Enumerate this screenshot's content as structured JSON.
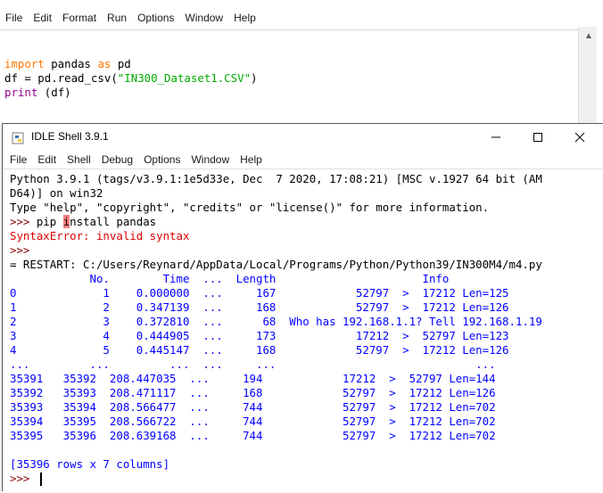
{
  "editor": {
    "menu": [
      "File",
      "Edit",
      "Format",
      "Run",
      "Options",
      "Window",
      "Help"
    ],
    "code": {
      "line1": {
        "kw1": "import",
        "mid": " pandas ",
        "kw2": "as",
        "end": " pd"
      },
      "line2": {
        "pre": "df = pd.read_csv(",
        "str": "\"IN300_Dataset1.CSV\"",
        "post": ")"
      },
      "line3": {
        "bi": "print",
        "post": " (df)"
      }
    }
  },
  "shell": {
    "title": "IDLE Shell 3.9.1",
    "menu": [
      "File",
      "Edit",
      "Shell",
      "Debug",
      "Options",
      "Window",
      "Help"
    ],
    "banner1": "Python 3.9.1 (tags/v3.9.1:1e5d33e, Dec  7 2020, 17:08:21) [MSC v.1927 64 bit (AM",
    "banner2": "D64)] on win32",
    "banner3": "Type \"help\", \"copyright\", \"credits\" or \"license()\" for more information.",
    "cmd": {
      "prompt": ">>> ",
      "pre": "pip ",
      "hl": "i",
      "post": "nstall pandas"
    },
    "error": "SyntaxError: invalid syntax",
    "prompt2": ">>>",
    "restart": "= RESTART: C:/Users/Reynard/AppData/Local/Programs/Python/Python39/IN300M4/m4.py",
    "table_lines": [
      "            No.        Time  ...  Length                      Info",
      "0             1    0.000000  ...     167            52797  >  17212 Len=125",
      "1             2    0.347139  ...     168            52797  >  17212 Len=126",
      "2             3    0.372810  ...      68  Who has 192.168.1.1? Tell 192.168.1.19",
      "3             4    0.444905  ...     173            17212  >  52797 Len=123",
      "4             5    0.445147  ...     168            52797  >  17212 Len=126",
      "...         ...         ...  ...     ...                              ...",
      "35391   35392  208.447035  ...     194            17212  >  52797 Len=144",
      "35392   35393  208.471117  ...     168            52797  >  17212 Len=126",
      "35393   35394  208.566477  ...     744            52797  >  17212 Len=702",
      "35394   35395  208.566722  ...     744            52797  >  17212 Len=702",
      "35395   35396  208.639168  ...     744            52797  >  17212 Len=702"
    ],
    "summary": "[35396 rows x 7 columns]",
    "prompt3": ">>> "
  }
}
